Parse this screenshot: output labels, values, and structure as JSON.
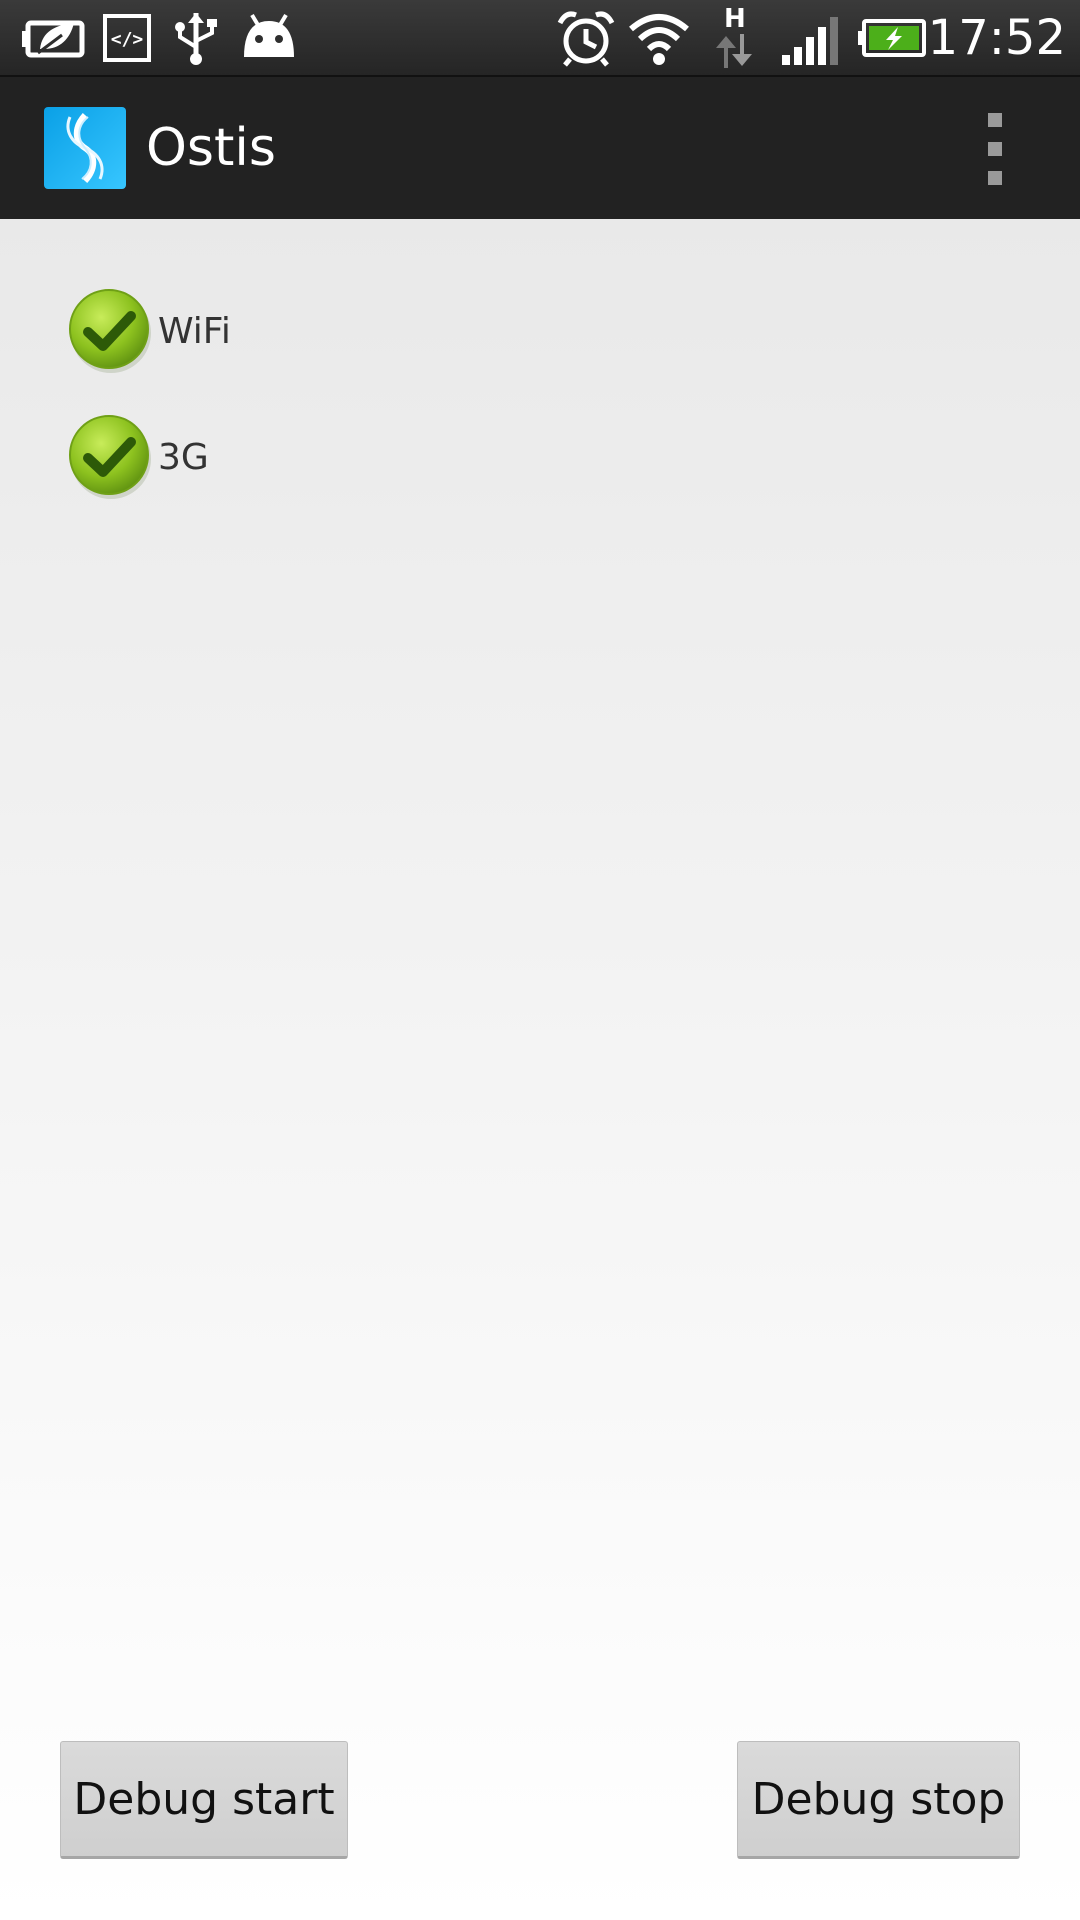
{
  "status_bar": {
    "icons": [
      "battery-saver-icon",
      "developer-code-icon",
      "usb-icon",
      "android-debug-icon",
      "alarm-icon",
      "wifi-icon",
      "hspa-data-icon",
      "signal-icon",
      "battery-charging-icon"
    ],
    "network_type": "H",
    "time": "17:52"
  },
  "action_bar": {
    "app_icon": "ostis-app-icon",
    "title": "Ostis",
    "menu_icon": "overflow-menu-icon"
  },
  "options": [
    {
      "label": "WiFi",
      "checked": true
    },
    {
      "label": "3G",
      "checked": true
    }
  ],
  "buttons": {
    "debug_start": "Debug start",
    "debug_stop": "Debug stop"
  },
  "colors": {
    "status_bar_bg": "#2e2e2e",
    "action_bar_bg": "#222222",
    "check_green": "#8dc21f",
    "battery_green": "#4caf1a",
    "button_bg": "#d5d5d5"
  }
}
